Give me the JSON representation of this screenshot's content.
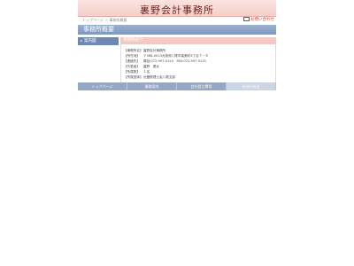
{
  "header": {
    "title": "裏野会計事務所"
  },
  "subbar": {
    "breadcrumb": "トップページ ＞ 事務所概要",
    "contact": "お問い合わせ"
  },
  "section": {
    "title": "事務所概要"
  },
  "sidenav": {
    "items": [
      {
        "label": "案内図"
      }
    ]
  },
  "content": {
    "heading": "事務所紹介",
    "rows": [
      {
        "key": "【事務所名】",
        "value": "裏野会計事務所"
      },
      {
        "key": "【所在地】",
        "value": "〒566-0013大阪府八尾市高美町4丁目７－８"
      },
      {
        "key": "【連絡先】",
        "value": "電話:072-997-0124　FAX:072-997-0125"
      },
      {
        "key": "【代表者】",
        "value": "裏野　優太"
      },
      {
        "key": "【所属数】",
        "value": "１名"
      },
      {
        "key": "【所属団体】",
        "value": "近畿税理士会八尾支部"
      }
    ]
  },
  "footer": {
    "items": [
      {
        "label": "トップページ"
      },
      {
        "label": "業務案内"
      },
      {
        "label": "会社設立費用"
      },
      {
        "label": "事務所概要"
      }
    ]
  }
}
